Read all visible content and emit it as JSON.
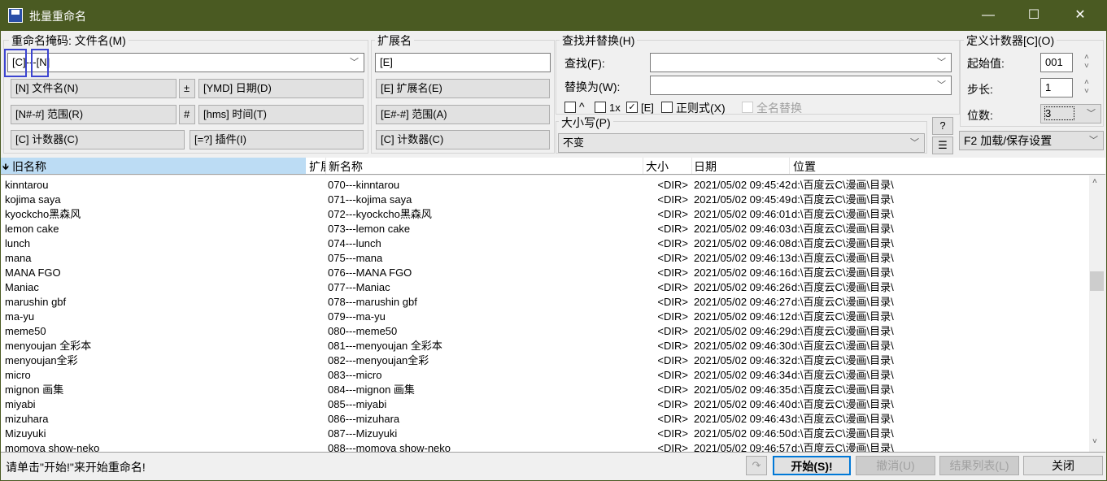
{
  "window": {
    "title": "批量重命名",
    "min": "—",
    "max": "☐",
    "close": "✕"
  },
  "mask": {
    "legend": "重命名掩码: 文件名(M)",
    "value": "[C]---[N]",
    "buttons": [
      "[N] 文件名(N)",
      "±",
      "[YMD] 日期(D)",
      "[N#-#] 范围(R)",
      "#",
      "[hms] 时间(T)",
      "[C] 计数器(C)",
      "[=?] 插件(I)"
    ]
  },
  "ext": {
    "legend": "扩展名",
    "value": "[E]",
    "buttons": [
      "[E] 扩展名(E)",
      "[E#-#] 范围(A)",
      "[C] 计数器(C)"
    ]
  },
  "find": {
    "legend": "查找并替换(H)",
    "find_label": "查找(F):",
    "find_value": "",
    "replace_label": "替换为(W):",
    "replace_value": "",
    "options": [
      {
        "label": "^",
        "checked": false
      },
      {
        "label": "1x",
        "checked": false
      },
      {
        "label": "[E]",
        "checked": true
      },
      {
        "label": "正则式(X)",
        "checked": false
      },
      {
        "label": "全名替换",
        "checked": false,
        "disabled": true
      }
    ]
  },
  "case": {
    "legend": "大小写(P)",
    "value": "不变",
    "help": "?"
  },
  "counter": {
    "legend": "定义计数器[C](O)",
    "start_label": "起始值:",
    "start": "001",
    "step_label": "步长:",
    "step": "1",
    "digits_label": "位数:",
    "digits": "3"
  },
  "settings": {
    "label": "F2 加载/保存设置"
  },
  "table": {
    "headers": [
      "旧名称",
      "扩展名",
      "新名称",
      "大小",
      "日期",
      "位置"
    ],
    "rows": [
      [
        "kinntarou",
        "070---kinntarou",
        "<DIR>",
        "2021/05/02 09:45:42",
        "d:\\百度云C\\漫画\\目录\\"
      ],
      [
        "kojima saya",
        "071---kojima saya",
        "<DIR>",
        "2021/05/02 09:45:49",
        "d:\\百度云C\\漫画\\目录\\"
      ],
      [
        "kyockcho黑森风",
        "072---kyockcho黑森风",
        "<DIR>",
        "2021/05/02 09:46:01",
        "d:\\百度云C\\漫画\\目录\\"
      ],
      [
        "lemon cake",
        "073---lemon cake",
        "<DIR>",
        "2021/05/02 09:46:03",
        "d:\\百度云C\\漫画\\目录\\"
      ],
      [
        "lunch",
        "074---lunch",
        "<DIR>",
        "2021/05/02 09:46:08",
        "d:\\百度云C\\漫画\\目录\\"
      ],
      [
        "mana",
        "075---mana",
        "<DIR>",
        "2021/05/02 09:46:13",
        "d:\\百度云C\\漫画\\目录\\"
      ],
      [
        "MANA   FGO",
        "076---MANA   FGO",
        "<DIR>",
        "2021/05/02 09:46:16",
        "d:\\百度云C\\漫画\\目录\\"
      ],
      [
        "Maniac",
        "077---Maniac",
        "<DIR>",
        "2021/05/02 09:46:26",
        "d:\\百度云C\\漫画\\目录\\"
      ],
      [
        "marushin gbf",
        "078---marushin gbf",
        "<DIR>",
        "2021/05/02 09:46:27",
        "d:\\百度云C\\漫画\\目录\\"
      ],
      [
        "ma-yu",
        "079---ma-yu",
        "<DIR>",
        "2021/05/02 09:46:12",
        "d:\\百度云C\\漫画\\目录\\"
      ],
      [
        "meme50",
        "080---meme50",
        "<DIR>",
        "2021/05/02 09:46:29",
        "d:\\百度云C\\漫画\\目录\\"
      ],
      [
        "menyoujan 全彩本",
        "081---menyoujan 全彩本",
        "<DIR>",
        "2021/05/02 09:46:30",
        "d:\\百度云C\\漫画\\目录\\"
      ],
      [
        "menyoujan全彩",
        "082---menyoujan全彩",
        "<DIR>",
        "2021/05/02 09:46:32",
        "d:\\百度云C\\漫画\\目录\\"
      ],
      [
        "micro",
        "083---micro",
        "<DIR>",
        "2021/05/02 09:46:34",
        "d:\\百度云C\\漫画\\目录\\"
      ],
      [
        "mignon 画集",
        "084---mignon 画集",
        "<DIR>",
        "2021/05/02 09:46:35",
        "d:\\百度云C\\漫画\\目录\\"
      ],
      [
        "miyabi",
        "085---miyabi",
        "<DIR>",
        "2021/05/02 09:46:40",
        "d:\\百度云C\\漫画\\目录\\"
      ],
      [
        "mizuhara",
        "086---mizuhara",
        "<DIR>",
        "2021/05/02 09:46:43",
        "d:\\百度云C\\漫画\\目录\\"
      ],
      [
        "Mizuyuki",
        "087---Mizuyuki",
        "<DIR>",
        "2021/05/02 09:46:50",
        "d:\\百度云C\\漫画\\目录\\"
      ],
      [
        "momoya show-neko",
        "088---momoya show-neko",
        "<DIR>",
        "2021/05/02 09:46:57",
        "d:\\百度云C\\漫画\\目录\\"
      ]
    ]
  },
  "status": {
    "text": "请单击\"开始!\"来开始重命名!",
    "start": "开始(S)!",
    "undo": "撤消(U)",
    "results": "结果列表(L)",
    "close": "关闭"
  },
  "colors": {
    "titlebar": "#4a5a22",
    "sort_header": "#bcdcf4",
    "focus": "#0078d7"
  }
}
